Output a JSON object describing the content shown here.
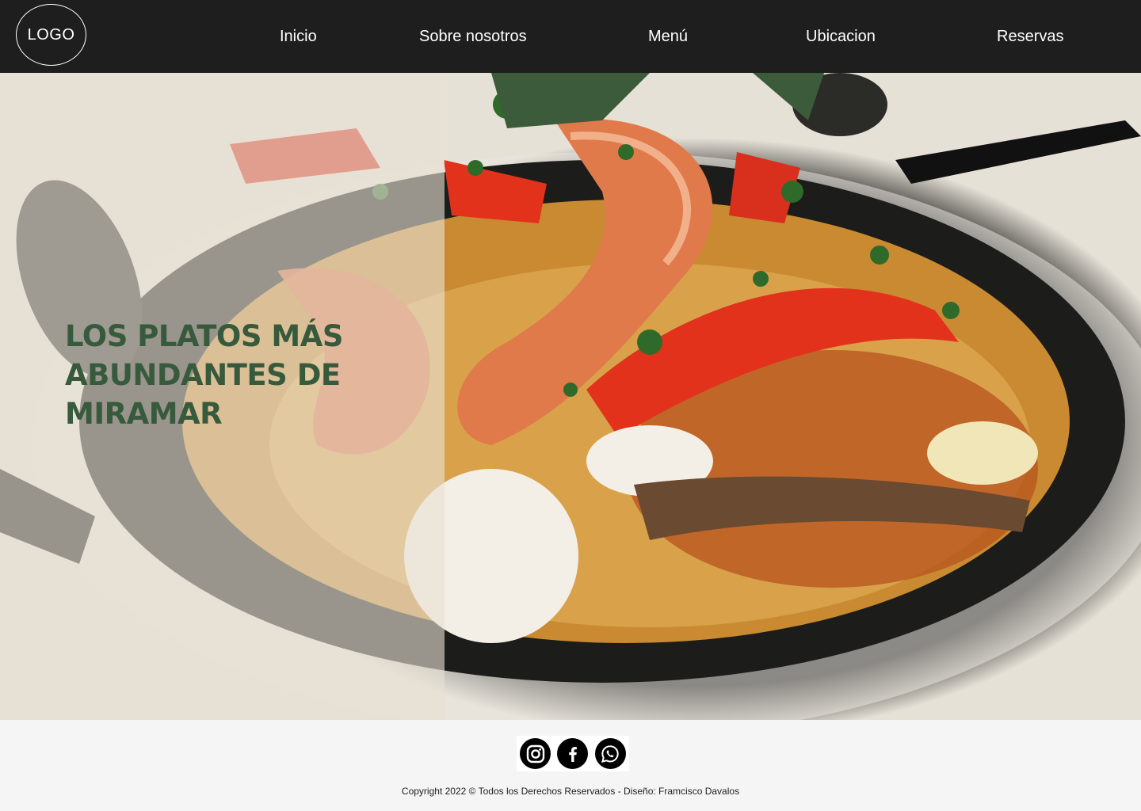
{
  "header": {
    "logo": "LOGO",
    "nav": [
      {
        "label": "Inicio"
      },
      {
        "label": "Sobre nosotros"
      },
      {
        "label": "Menú"
      },
      {
        "label": "Ubicacion"
      },
      {
        "label": "Reservas"
      }
    ]
  },
  "hero": {
    "headline": "LOS PLATOS MÁS ABUNDANTES DE MIRAMAR",
    "image_icon": "paella-dish-photo"
  },
  "footer": {
    "social": [
      {
        "icon": "instagram-icon"
      },
      {
        "icon": "facebook-icon"
      },
      {
        "icon": "whatsapp-icon"
      }
    ],
    "copyright": "Copyright 2022 © Todos los Derechos Reservados - Diseño: Framcisco Davalos"
  },
  "colors": {
    "nav_bg": "#1e1e1e",
    "headline": "#375a3c",
    "footer_bg": "#f5f5f5"
  }
}
